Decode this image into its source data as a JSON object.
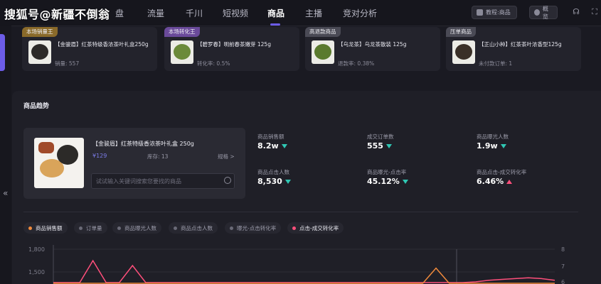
{
  "watermark": "搜狐号@新疆不倒翁",
  "nav": {
    "items": [
      {
        "label": "盘",
        "active": false
      },
      {
        "label": "流量",
        "active": false
      },
      {
        "label": "千川",
        "active": false
      },
      {
        "label": "短视频",
        "active": false
      },
      {
        "label": "商品",
        "active": true
      },
      {
        "label": "主播",
        "active": false
      },
      {
        "label": "竞对分析",
        "active": false
      }
    ],
    "tutorial": "教程:商品",
    "overview": "概览"
  },
  "cards": [
    {
      "badge": "本场销量王",
      "badge_color": "#8a6a2a",
      "title": "【金骏眉】红茶特级香浓茶叶礼盒250g",
      "meta": "销量: 557"
    },
    {
      "badge": "本场转化王",
      "badge_color": "#6a4a9a",
      "title": "【碧罗春】明前春茶嫩芽 125g",
      "meta": "转化率: 0.5%"
    },
    {
      "badge": "高退款商品",
      "badge_color": "#4a4a55",
      "title": "【乌龙茶】乌龙茶散装 125g",
      "meta": "退款率: 0.38%"
    },
    {
      "badge": "压单商品",
      "badge_color": "#4a4a55",
      "title": "【正山小种】红茶茶叶浓香型125g",
      "meta": "未付款订单: 1"
    }
  ],
  "trend": {
    "title": "商品趋势",
    "product": {
      "name": "【金骏眉】红茶特级香浓茶叶礼盒 250g",
      "price": "¥129",
      "stock": "库存: 13",
      "spec": "规格 >"
    },
    "search_placeholder": "试试输入关键词搜索您要找的商品",
    "metrics": [
      {
        "label": "商品销售额",
        "value": "8.2w",
        "dir": "down"
      },
      {
        "label": "成交订单数",
        "value": "555",
        "dir": "down"
      },
      {
        "label": "商品曝光人数",
        "value": "1.9w",
        "dir": "down"
      },
      {
        "label": "商品点击人数",
        "value": "8,530",
        "dir": "down"
      },
      {
        "label": "商品曝光-点击率",
        "value": "45.12%",
        "dir": "down"
      },
      {
        "label": "商品点击-成交转化率",
        "value": "6.46%",
        "dir": "up"
      }
    ],
    "legend": [
      {
        "label": "商品销售额",
        "color": "#f08a3c",
        "active": true
      },
      {
        "label": "订单量",
        "color": "#6a6a77",
        "active": false
      },
      {
        "label": "商品曝光人数",
        "color": "#6a6a77",
        "active": false
      },
      {
        "label": "商品点击人数",
        "color": "#6a6a77",
        "active": false
      },
      {
        "label": "曝光-点击转化率",
        "color": "#6a6a77",
        "active": false
      },
      {
        "label": "点击-成交转化率",
        "color": "#ff4f7b",
        "active": true
      }
    ]
  },
  "chart_data": {
    "type": "line",
    "y_left_ticks": [
      "1,800",
      "1,500"
    ],
    "y_right_ticks": [
      "8",
      "7",
      "6"
    ],
    "series": [
      {
        "color": "#ff4f7b",
        "values": [
          0.2,
          0.3,
          0.25,
          7.3,
          0.2,
          0.2,
          7.0,
          0.3,
          0.2,
          0.2,
          0.2,
          0.3,
          0.2,
          0.2,
          0.2,
          0.2,
          0.2,
          0.2,
          0.2,
          0.2,
          0.25,
          0.2,
          0.2,
          0.2,
          0.3,
          0.2,
          0.2,
          0.2,
          0.2,
          0.2,
          0.2,
          0.2,
          6.0,
          6.1,
          6.15,
          6.2,
          6.25,
          6.2,
          6.1
        ]
      },
      {
        "color": "#f08a3c",
        "values": [
          0,
          0,
          0,
          0,
          0,
          0,
          0,
          0,
          0,
          0,
          0,
          0,
          0,
          0,
          0,
          0,
          0,
          0,
          0,
          0,
          0,
          0,
          0,
          0,
          0,
          0,
          0,
          0,
          0,
          1550,
          0,
          0,
          0,
          0,
          0,
          0,
          0,
          0,
          0
        ]
      }
    ]
  }
}
